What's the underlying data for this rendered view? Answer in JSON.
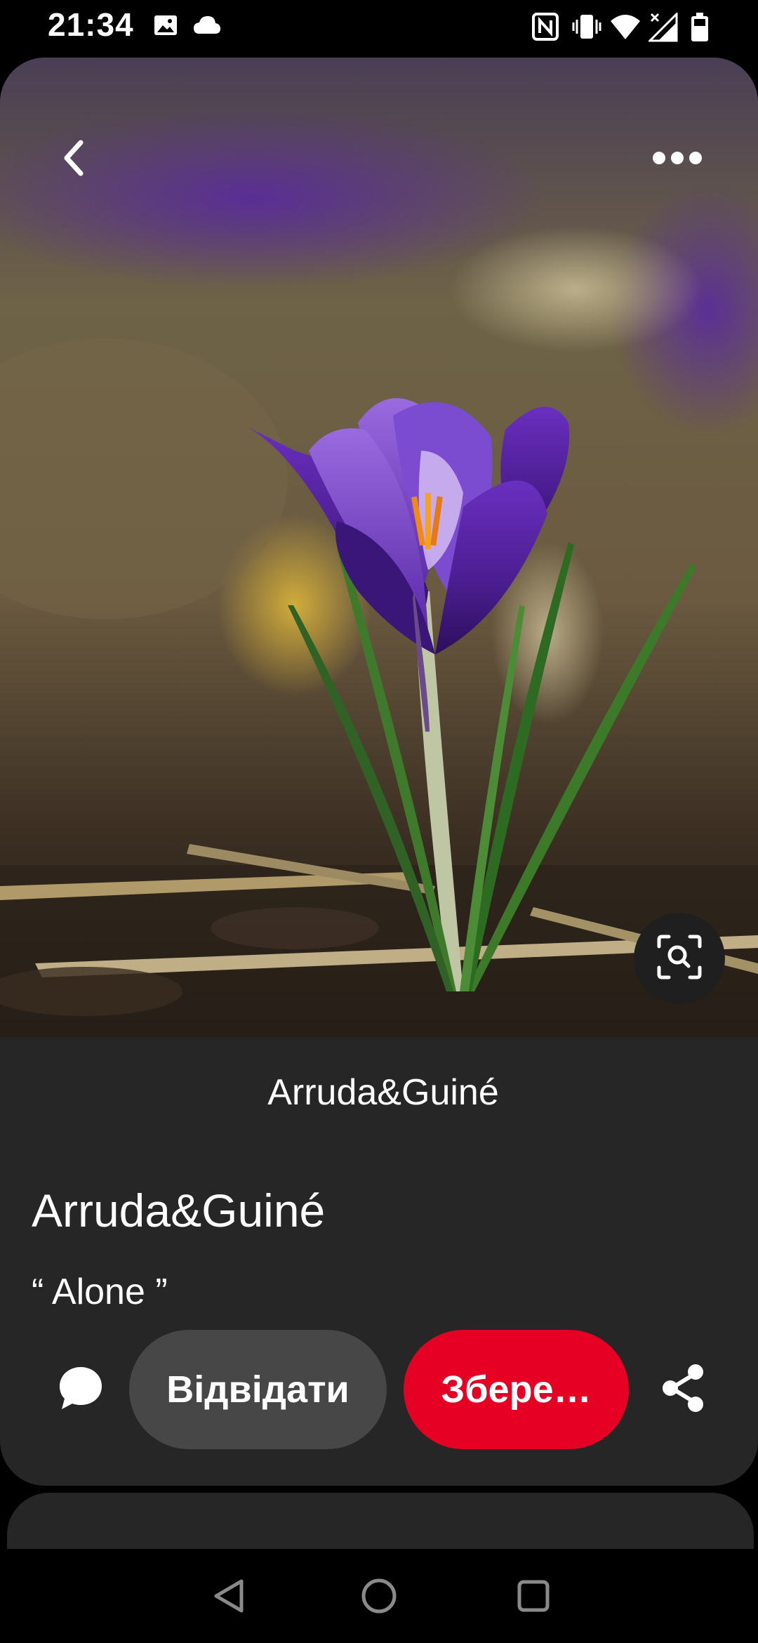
{
  "status_bar": {
    "time": "21:34",
    "left_icons": [
      "image-icon",
      "cloud-icon"
    ],
    "right_icons": [
      "nfc-icon",
      "vibrate-icon",
      "wifi-icon",
      "signal-icon",
      "battery-icon"
    ]
  },
  "pin": {
    "board_name": "Arruda&Guiné",
    "title": "Arruda&Guiné",
    "description": "“ Alone ”",
    "image_subject": "purple crocus flower"
  },
  "actions": {
    "visit_label": "Відвідати",
    "save_label": "Збере…"
  },
  "icons": {
    "back": "chevron-left-icon",
    "more": "more-horizontal-icon",
    "lens": "visual-search-icon",
    "comment": "comment-icon",
    "share": "share-icon"
  },
  "colors": {
    "card_bg": "#262626",
    "visit_bg": "#474747",
    "save_bg": "#e60023",
    "text": "#ffffff"
  }
}
